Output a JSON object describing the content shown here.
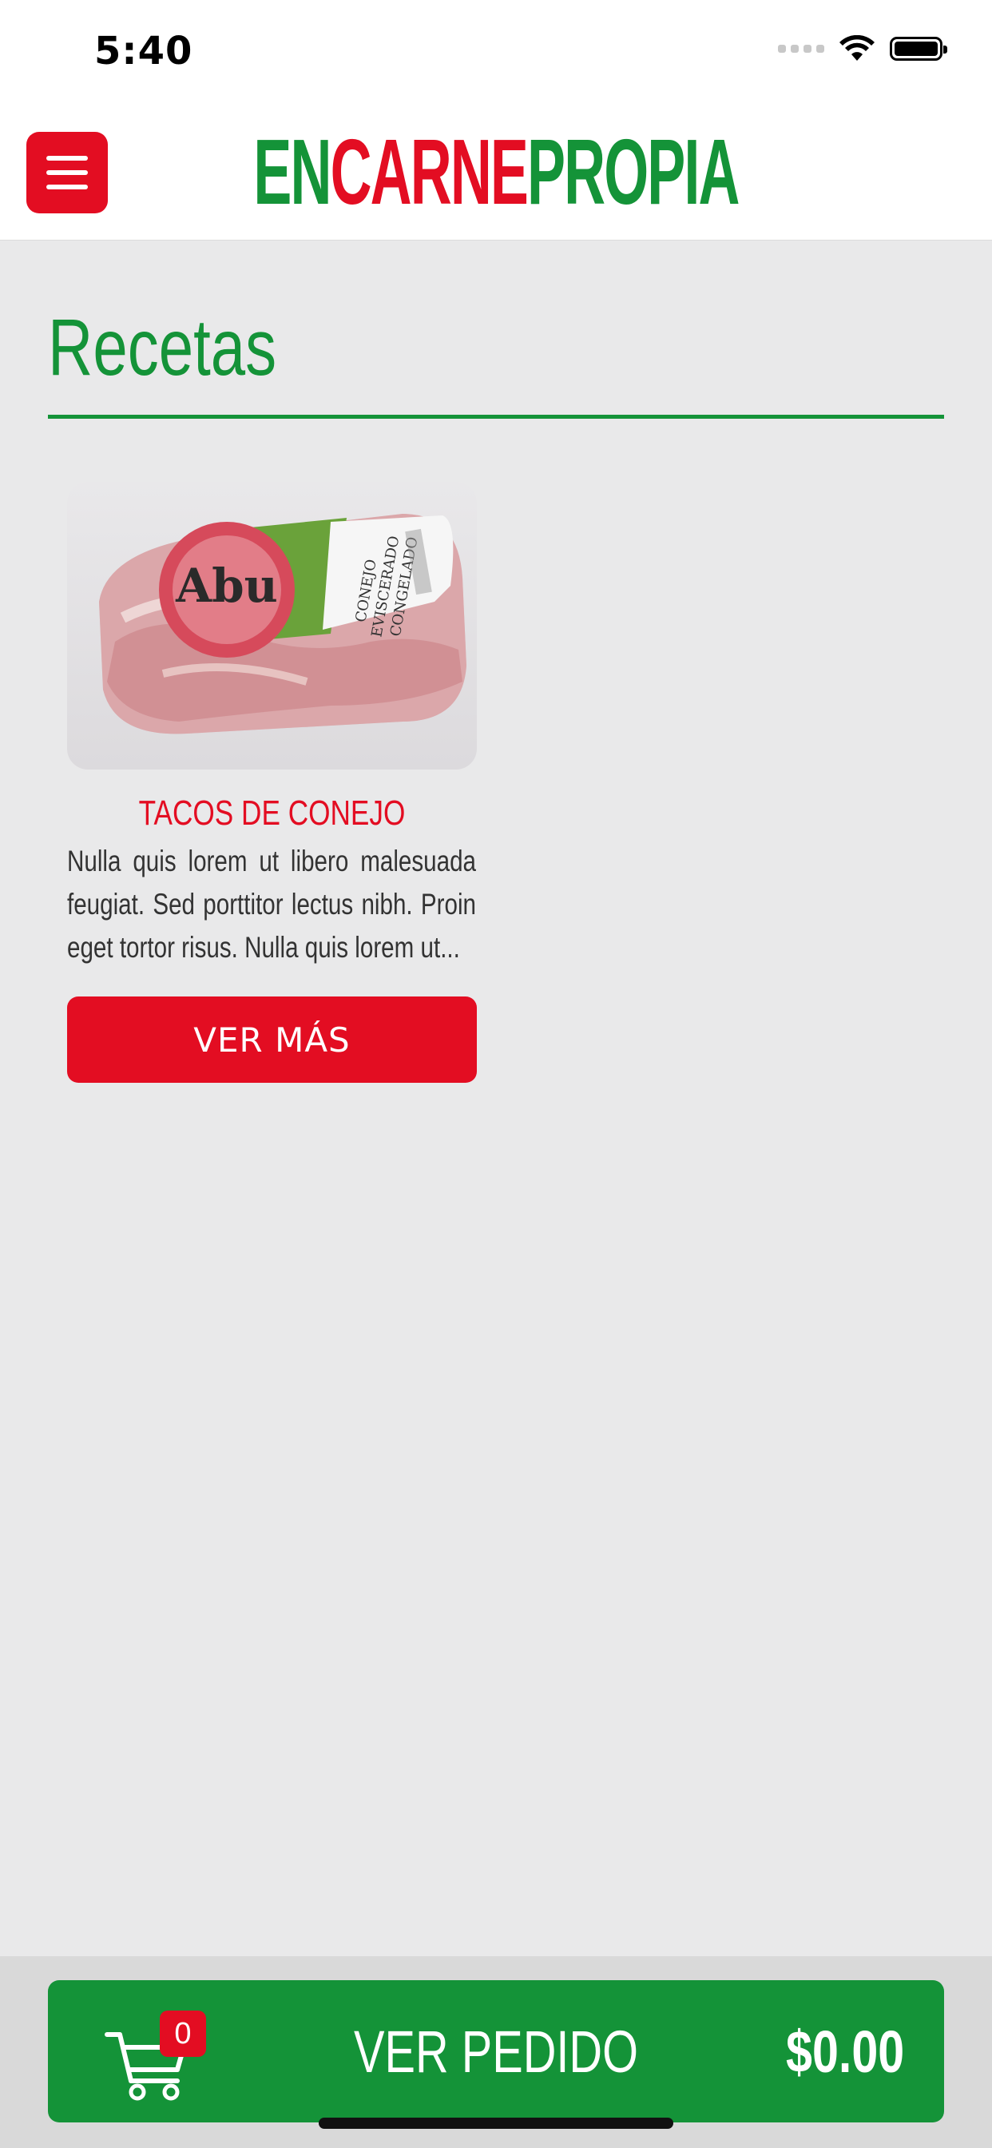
{
  "status_bar": {
    "time": "5:40"
  },
  "header": {
    "logo_part1": "EN",
    "logo_part2": "CARNE",
    "logo_part3": "PROPIA",
    "colors": {
      "green": "#149338",
      "red": "#e30d22"
    }
  },
  "page": {
    "title": "Recetas"
  },
  "recipes": [
    {
      "title": "TACOS DE CONEJO",
      "description": "Nulla quis lorem ut libero malesuada feugiat. Sed porttitor lectus nibh. Proin eget tortor risus. Nulla quis lorem ut...",
      "button_label": "VER MÁS",
      "package_text": {
        "brand": "Abu",
        "lines": [
          "CONEJO",
          "EVISCERADO",
          "CONGELADO"
        ]
      }
    }
  ],
  "cart": {
    "count": "0",
    "order_label": "VER PEDIDO",
    "total": "$0.00"
  }
}
